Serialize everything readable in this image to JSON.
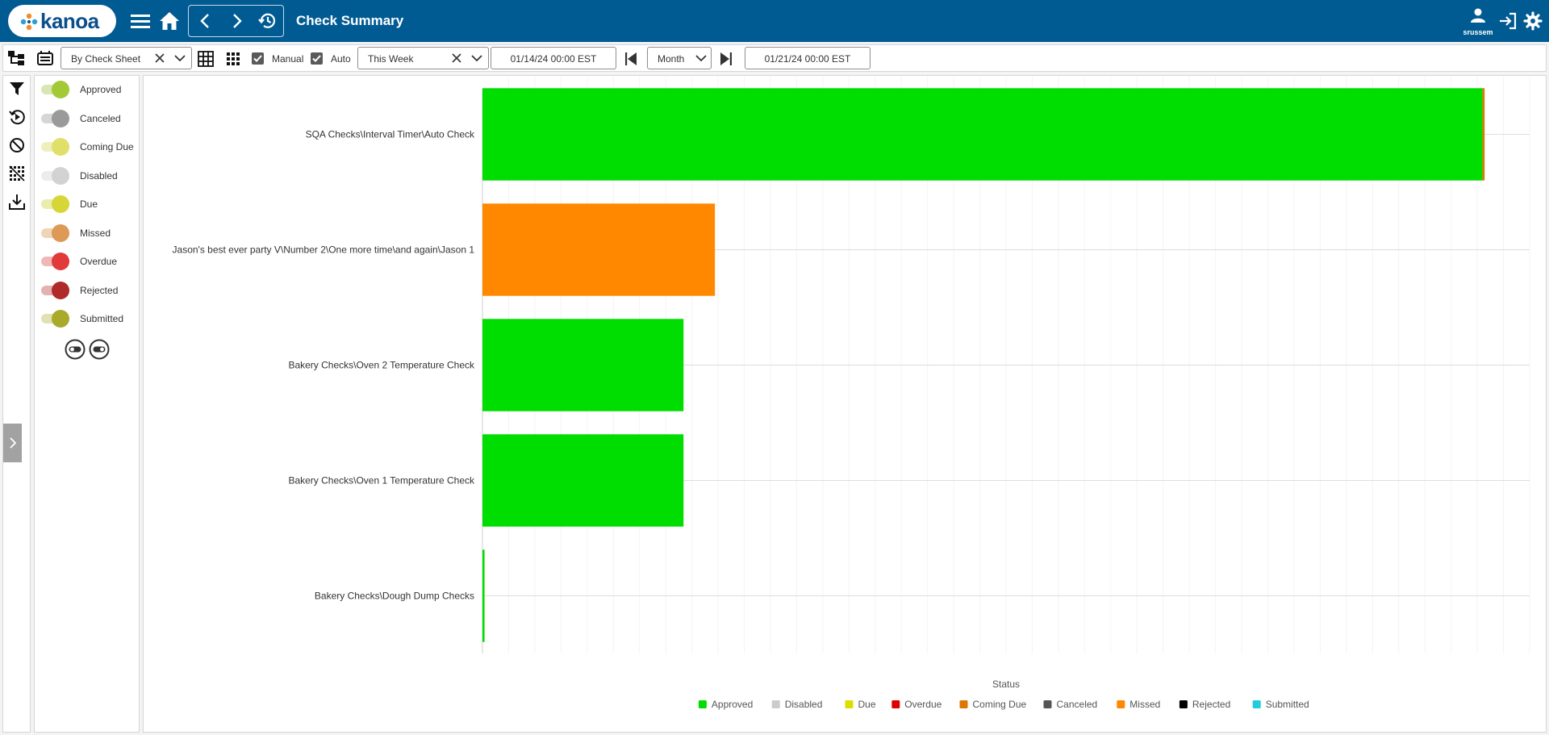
{
  "app": {
    "logo_text": "kanoa",
    "title": "Check Summary",
    "user": "srussem"
  },
  "toolbar": {
    "group_by": "By Check Sheet",
    "manual_label": "Manual",
    "manual_checked": true,
    "auto_label": "Auto",
    "auto_checked": true,
    "period": "This Week",
    "start_date": "01/14/24 00:00 EST",
    "interval": "Month",
    "end_date": "01/21/24 00:00 EST"
  },
  "status_toggles": [
    {
      "label": "Approved",
      "knob": "#a3c935",
      "track": "#d8e6b4"
    },
    {
      "label": "Canceled",
      "knob": "#9a9a9a",
      "track": "#d6d6d6"
    },
    {
      "label": "Coming Due",
      "knob": "#dfdf6a",
      "track": "#efefbd"
    },
    {
      "label": "Disabled",
      "knob": "#d2d2d2",
      "track": "#ececec"
    },
    {
      "label": "Due",
      "knob": "#d6d637",
      "track": "#ececad"
    },
    {
      "label": "Missed",
      "knob": "#dd9955",
      "track": "#f0d4b8"
    },
    {
      "label": "Overdue",
      "knob": "#e03a3a",
      "track": "#f1b7b7"
    },
    {
      "label": "Rejected",
      "knob": "#b02a2a",
      "track": "#e4b1b1"
    },
    {
      "label": "Submitted",
      "knob": "#a9a92c",
      "track": "#e1e1b5"
    }
  ],
  "chart_data": {
    "type": "bar",
    "orientation": "horizontal",
    "stacked": true,
    "categories": [
      "SQA Checks\\Interval Timer\\Auto Check",
      "Jason's best ever party V\\Number 2\\One more time\\and again\\Jason 1",
      "Bakery Checks\\Oven 2 Temperature Check",
      "Bakery Checks\\Oven 1 Temperature Check",
      "Bakery Checks\\Dough Dump Checks"
    ],
    "series": [
      {
        "name": "Approved",
        "color": "#00dd00",
        "values": [
          955,
          0,
          192,
          192,
          2
        ]
      },
      {
        "name": "Disabled",
        "color": "#cccccc",
        "values": [
          0,
          0,
          0,
          0,
          0
        ]
      },
      {
        "name": "Due",
        "color": "#dddd00",
        "values": [
          0,
          0,
          0,
          0,
          0
        ]
      },
      {
        "name": "Overdue",
        "color": "#dd0000",
        "values": [
          0,
          0,
          0,
          0,
          0
        ]
      },
      {
        "name": "Coming Due",
        "color": "#dd7700",
        "values": [
          2,
          0,
          0,
          0,
          0
        ]
      },
      {
        "name": "Canceled",
        "color": "#555555",
        "values": [
          0,
          0,
          0,
          0,
          0
        ]
      },
      {
        "name": "Missed",
        "color": "#ff8800",
        "values": [
          0,
          222,
          0,
          0,
          0
        ]
      },
      {
        "name": "Rejected",
        "color": "#000000",
        "values": [
          0,
          0,
          0,
          0,
          0
        ]
      },
      {
        "name": "Submitted",
        "color": "#22ccdd",
        "values": [
          0,
          0,
          0,
          0,
          0
        ]
      }
    ],
    "xlim": [
      0,
      1000
    ],
    "legend_title": "Status",
    "legend_position": "bottom",
    "grid": true
  }
}
